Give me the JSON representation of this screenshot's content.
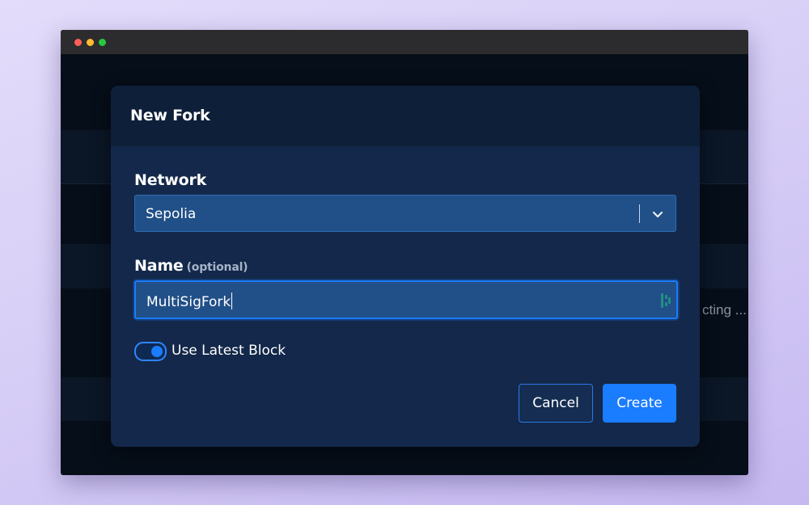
{
  "window": {
    "background_text": "cting ..."
  },
  "modal": {
    "title": "New Fork",
    "network": {
      "label": "Network",
      "selected": "Sepolia"
    },
    "name": {
      "label": "Name",
      "optional_hint": "(optional)",
      "value": "MultiSigFork"
    },
    "toggle": {
      "label": "Use Latest Block",
      "checked": true
    },
    "buttons": {
      "cancel": "Cancel",
      "create": "Create"
    }
  },
  "colors": {
    "accent": "#1a7cff",
    "modal_bg": "#13284a",
    "header_bg": "#0e1f39",
    "input_bg": "#214f87",
    "window_bg": "#060e19"
  },
  "icons": {
    "select": "chevron-down-icon",
    "input": "password-manager-icon"
  }
}
